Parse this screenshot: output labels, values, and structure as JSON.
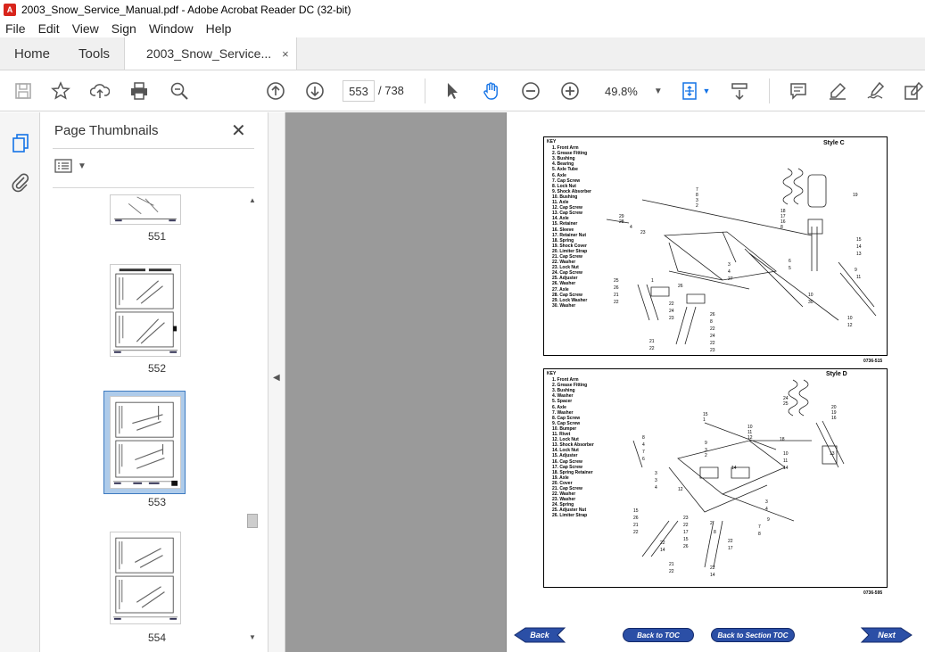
{
  "window": {
    "title": "2003_Snow_Service_Manual.pdf - Adobe Acrobat Reader DC (32-bit)",
    "app_icon_label": "A"
  },
  "menu": [
    "File",
    "Edit",
    "View",
    "Sign",
    "Window",
    "Help"
  ],
  "tabs": {
    "home": "Home",
    "tools": "Tools",
    "document": "2003_Snow_Service...",
    "close_glyph": "×"
  },
  "toolbar": {
    "current_page": "553",
    "total_pages": "/ 738",
    "zoom": "49.8%",
    "icons": [
      "save-icon",
      "bookmark-star-icon",
      "upload-icon",
      "print-icon",
      "find-icon",
      "previous-page-icon",
      "next-page-icon",
      "select-arrow-icon",
      "hand-icon",
      "zoom-out-icon",
      "zoom-in-icon",
      "fit-page-icon",
      "scroll-mode-icon",
      "comment-icon",
      "highlight-icon",
      "sign-icon",
      "edit-icon"
    ]
  },
  "sidebar": {
    "title": "Page Thumbnails",
    "close_glyph": "✕",
    "thumbnails": [
      {
        "label": "551"
      },
      {
        "label": "552"
      },
      {
        "label": "553",
        "selected": true
      },
      {
        "label": "554"
      }
    ]
  },
  "collapse_glyph": "◀",
  "document": {
    "figure_c": {
      "key_title": "KEY",
      "style": "Style C",
      "code": "0736-515",
      "items": [
        "1. Front Arm",
        "2. Grease Fitting",
        "3. Bushing",
        "4. Bearing",
        "5. Axle Tube",
        "6. Axle",
        "7. Cap Screw",
        "8. Lock Nut",
        "9. Shock Absorber",
        "10. Bushing",
        "11. Axle",
        "12. Cap Screw",
        "13. Cap Screw",
        "14. Axle",
        "15. Retainer",
        "16. Sleeve",
        "17. Retainer Nut",
        "18. Spring",
        "19. Shock Cover",
        "20. Limiter Strap",
        "21. Cap Screw",
        "22. Washer",
        "23. Lock Nut",
        "24. Cap Screw",
        "25. Adjuster",
        "26. Washer",
        "27. Axle",
        "28. Cap Screw",
        "29. Lock Washer",
        "30. Washer"
      ]
    },
    "figure_d": {
      "key_title": "KEY",
      "style": "Style D",
      "code": "0736-595",
      "items": [
        "1. Front Arm",
        "2. Grease Fitting",
        "3. Bushing",
        "4. Washer",
        "5. Spacer",
        "6. Axle",
        "7. Washer",
        "8. Cap Screw",
        "9. Cap Screw",
        "10. Bumper",
        "11. Rivet",
        "12. Lock Nut",
        "13. Shock Absorber",
        "14. Lock Nut",
        "15. Adjuster",
        "16. Cap Screw",
        "17. Cap Screw",
        "18. Spring Retainer",
        "19. Axle",
        "20. Cover",
        "21. Cap Screw",
        "22. Washer",
        "23. Washer",
        "24. Spring",
        "25. Adjuster Nut",
        "26. Limiter Strap"
      ]
    },
    "nav": {
      "back": "Back",
      "toc": "Back to TOC",
      "section_toc": "Back to Section TOC",
      "next": "Next"
    }
  }
}
